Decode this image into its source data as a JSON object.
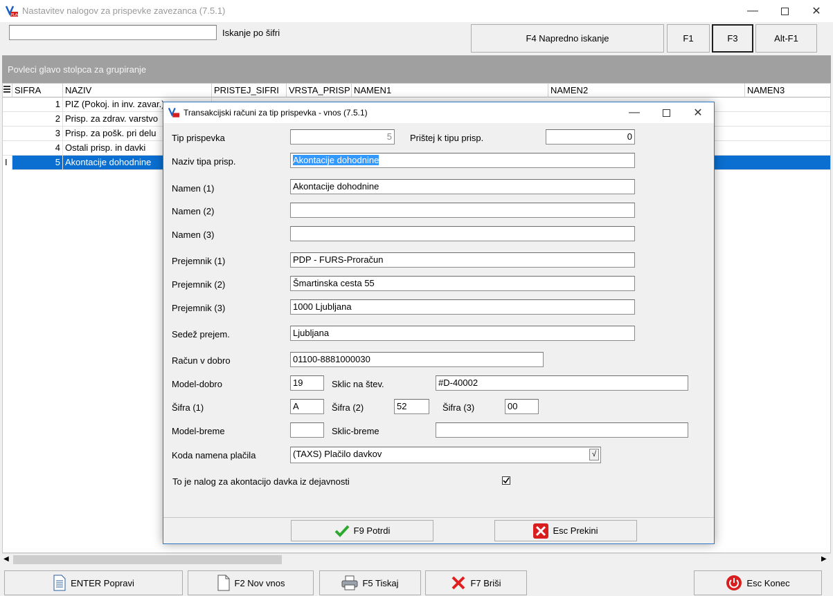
{
  "main": {
    "title": "Nastavitev nalogov za prispevke zavezanca  (7.5.1)",
    "search_label": "Iskanje po šifri",
    "search_value": "",
    "buttons": {
      "advanced": "F4  Napredno iskanje",
      "f1": "F1",
      "f3": "F3",
      "altf1": "Alt-F1"
    },
    "group_hint": "Povleci glavo stolpca za grupiranje",
    "columns": [
      "SIFRA",
      "NAZIV",
      "PRISTEJ_SIFRI",
      "VRSTA_PRISP",
      "NAMEN1",
      "NAMEN2",
      "NAMEN3"
    ],
    "rows": [
      {
        "sifra": "1",
        "naziv": "PIZ (Pokoj. in inv. zavar.)"
      },
      {
        "sifra": "2",
        "naziv": "Prisp. za zdrav. varstvo"
      },
      {
        "sifra": "3",
        "naziv": "Prisp. za pošk. pri delu"
      },
      {
        "sifra": "4",
        "naziv": "Ostali prisp. in davki"
      },
      {
        "sifra": "5",
        "naziv": "Akontacije dohodnine"
      }
    ],
    "footer": {
      "edit": "ENTER Popravi",
      "new": "F2 Nov vnos",
      "print": "F5 Tiskaj",
      "delete": "F7 Briši",
      "exit": "Esc Konec"
    }
  },
  "dialog": {
    "title": "Transakcijski računi za tip prispevka - vnos  (7.5.1)",
    "labels": {
      "tip": "Tip prispevka",
      "pristej": "Prištej k tipu prisp.",
      "naziv": "Naziv tipa prisp.",
      "namen1": "Namen (1)",
      "namen2": "Namen (2)",
      "namen3": "Namen (3)",
      "prejemnik1": "Prejemnik (1)",
      "prejemnik2": "Prejemnik (2)",
      "prejemnik3": "Prejemnik (3)",
      "sedez": "Sedež prejem.",
      "racun": "Račun v dobro",
      "model_dobro": "Model-dobro",
      "sklic_stev": "Sklic na štev.",
      "sifra1": "Šifra (1)",
      "sifra2": "Šifra (2)",
      "sifra3": "Šifra (3)",
      "model_breme": "Model-breme",
      "sklic_breme": "Sklic-breme",
      "koda": "Koda namena plačila",
      "akontacija": "To je nalog za akontacijo davka iz dejavnosti"
    },
    "values": {
      "tip": "5",
      "pristej": "0",
      "naziv": "Akontacije dohodnine",
      "namen1": "Akontacije dohodnine",
      "namen2": "",
      "namen3": "",
      "prejemnik1": "PDP - FURS-Proračun",
      "prejemnik2": "Šmartinska cesta 55",
      "prejemnik3": "1000 Ljubljana",
      "sedez": "Ljubljana",
      "racun": "01100-8881000030",
      "model_dobro": "19",
      "sklic_stev": "#D-40002",
      "sifra1": "A",
      "sifra2": "52",
      "sifra3": "00",
      "model_breme": "",
      "sklic_breme": "",
      "koda": "(TAXS) Plačilo davkov",
      "koda_dropdown": "√",
      "akontacija_checked": true
    },
    "buttons": {
      "confirm": "F9 Potrdi",
      "cancel": "Esc Prekini"
    }
  },
  "colors": {
    "selection": "#0a6fd1",
    "group_bar": "#a0a0a0",
    "dialog_border": "#2d77c7",
    "highlight": "#3399ff"
  }
}
